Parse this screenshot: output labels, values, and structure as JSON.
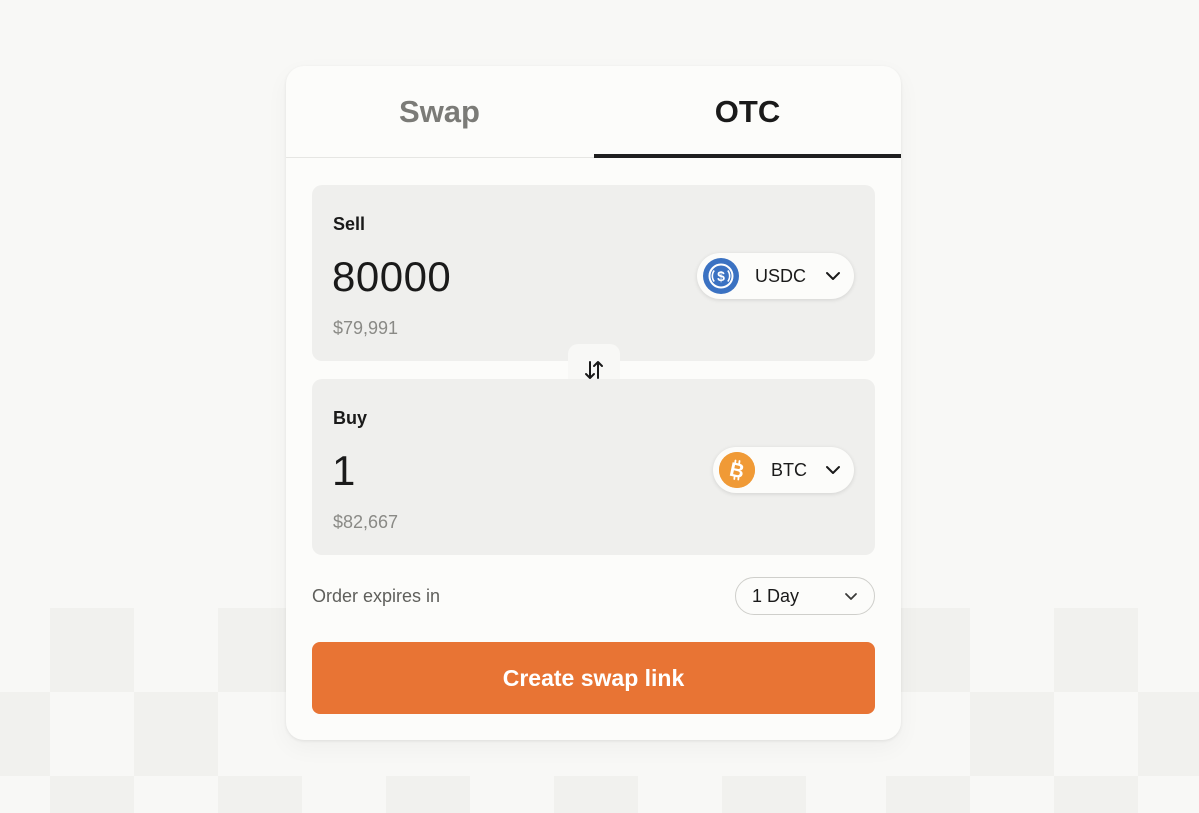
{
  "tabs": [
    {
      "label": "Swap",
      "active": false
    },
    {
      "label": "OTC",
      "active": true
    }
  ],
  "sell": {
    "label": "Sell",
    "amount": "80000",
    "fiat_value": "$79,991",
    "token": {
      "symbol": "USDC",
      "icon": "usdc-icon",
      "color": "#3b72c2"
    }
  },
  "buy": {
    "label": "Buy",
    "amount": "1",
    "fiat_value": "$82,667",
    "token": {
      "symbol": "BTC",
      "icon": "btc-icon",
      "color": "#f09a36"
    }
  },
  "switch": {
    "icon": "swap-arrows-icon"
  },
  "expiry": {
    "label": "Order expires in",
    "selected": "1 Day"
  },
  "cta": {
    "label": "Create swap link",
    "color": "#e87434"
  }
}
